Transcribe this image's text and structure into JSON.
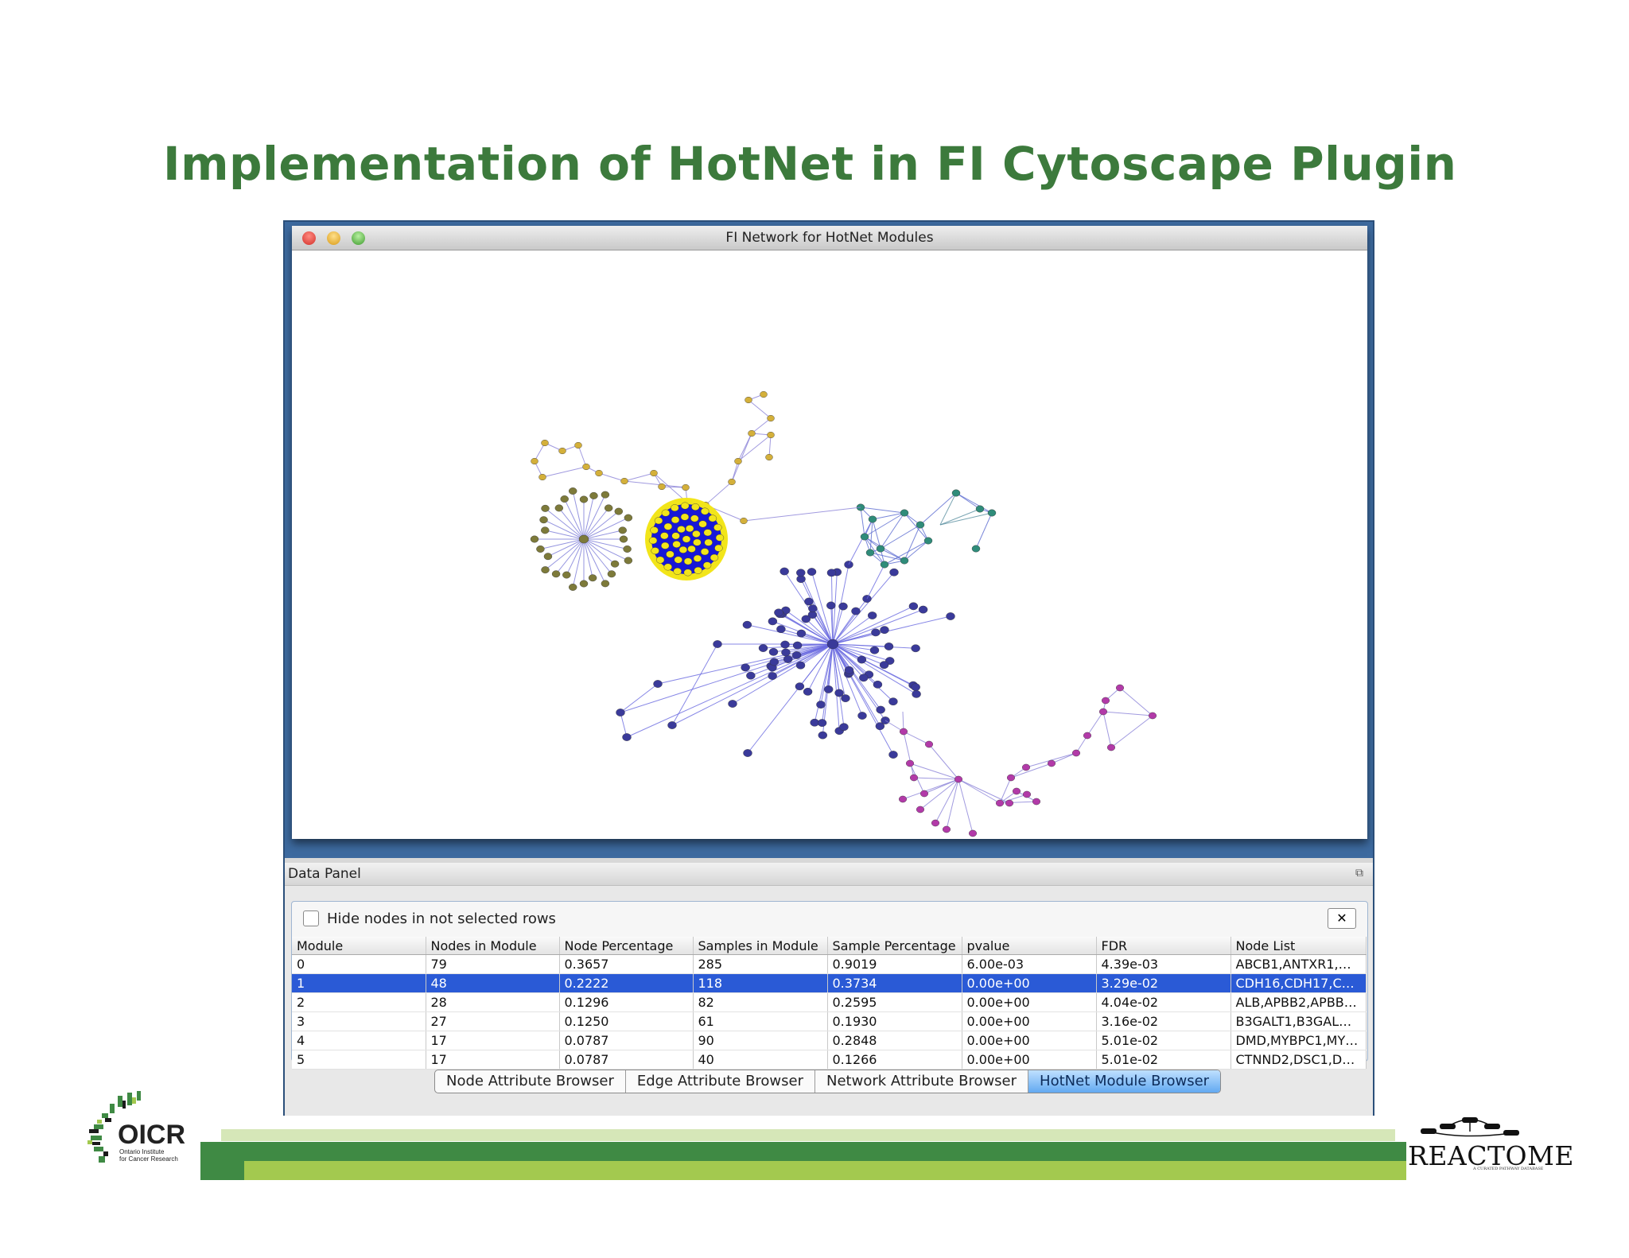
{
  "slide": {
    "title": "Implementation of HotNet in FI Cytoscape Plugin"
  },
  "network_window": {
    "title": "FI Network for HotNet Modules"
  },
  "data_panel": {
    "title": "Data Panel",
    "hide_nodes_label": "Hide nodes in not selected rows",
    "close_label": "✕",
    "columns": [
      "Module",
      "Nodes in Module",
      "Node Percentage",
      "Samples in Module",
      "Sample Percentage",
      "pvalue",
      "FDR",
      "Node List"
    ],
    "rows": [
      [
        "0",
        "79",
        "0.3657",
        "285",
        "0.9019",
        "6.00e-03",
        "4.39e-03",
        "ABCB1,ANTXR1,…"
      ],
      [
        "1",
        "48",
        "0.2222",
        "118",
        "0.3734",
        "0.00e+00",
        "3.29e-02",
        "CDH16,CDH17,C…"
      ],
      [
        "2",
        "28",
        "0.1296",
        "82",
        "0.2595",
        "0.00e+00",
        "4.04e-02",
        "ALB,APBB2,APBB…"
      ],
      [
        "3",
        "27",
        "0.1250",
        "61",
        "0.1930",
        "0.00e+00",
        "3.16e-02",
        "B3GALT1,B3GAL…"
      ],
      [
        "4",
        "17",
        "0.0787",
        "90",
        "0.2848",
        "0.00e+00",
        "5.01e-02",
        "DMD,MYBPC1,MY…"
      ],
      [
        "5",
        "17",
        "0.0787",
        "40",
        "0.1266",
        "0.00e+00",
        "5.01e-02",
        "CTNND2,DSC1,D…"
      ]
    ],
    "selected_row": 1,
    "tabs": [
      "Node Attribute Browser",
      "Edge Attribute Browser",
      "Network Attribute Browser",
      "HotNet Module Browser"
    ],
    "active_tab": 3
  },
  "logos": {
    "oicr_name": "OICR",
    "oicr_subtitle_1": "Ontario Institute",
    "oicr_subtitle_2": "for Cancer Research",
    "reactome_name": "REACTOME",
    "reactome_subtitle": "A CURATED PATHWAY DATABASE"
  },
  "colors": {
    "title_green": "#3c7a3c",
    "module_blue": "#3a3a9a",
    "module_teal": "#2f8c7a",
    "module_gold": "#d4b03a",
    "module_olive": "#7d7a3a",
    "module_yellow": "#f2e51a",
    "module_magenta": "#b23aa8",
    "selection": "#2a5ad6"
  }
}
